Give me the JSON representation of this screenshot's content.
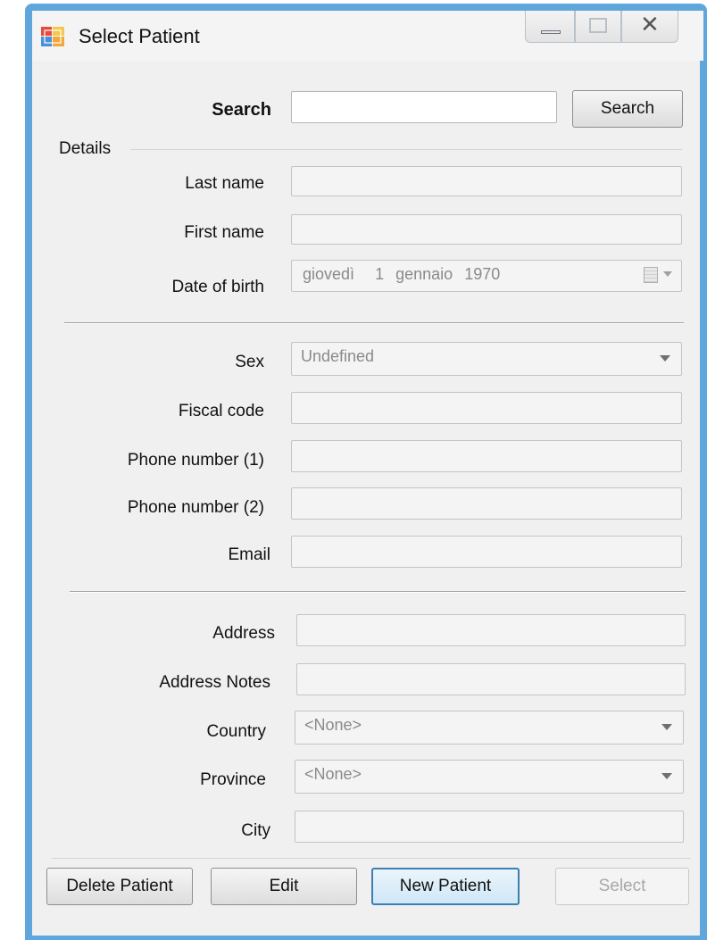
{
  "window": {
    "title": "Select Patient"
  },
  "search": {
    "label": "Search",
    "value": "",
    "button_label": "Search"
  },
  "details": {
    "group_label": "Details",
    "last_name": {
      "label": "Last name",
      "value": ""
    },
    "first_name": {
      "label": "First name",
      "value": ""
    },
    "date_of_birth": {
      "label": "Date of birth",
      "weekday": "giovedì",
      "day": "1",
      "month": "gennaio",
      "year": "1970"
    },
    "sex": {
      "label": "Sex",
      "value": "Undefined"
    },
    "fiscal_code": {
      "label": "Fiscal code",
      "value": ""
    },
    "phone1": {
      "label": "Phone number (1)",
      "value": ""
    },
    "phone2": {
      "label": "Phone number (2)",
      "value": ""
    },
    "email": {
      "label": "Email",
      "value": ""
    },
    "address": {
      "label": "Address",
      "value": ""
    },
    "address_notes": {
      "label": "Address Notes",
      "value": ""
    },
    "country": {
      "label": "Country",
      "value": "<None>"
    },
    "province": {
      "label": "Province",
      "value": "<None>"
    },
    "city": {
      "label": "City",
      "value": ""
    }
  },
  "actions": {
    "delete_label": "Delete Patient",
    "edit_label": "Edit",
    "new_label": "New Patient",
    "select_label": "Select"
  },
  "colors": {
    "window_frame": "#5fa6dd",
    "client_bg": "#f0f0f0",
    "default_button_border": "#3c7fb1"
  },
  "icons": {
    "app": "app-window-icon",
    "minimize": "minimize-icon",
    "maximize": "maximize-icon",
    "close": "close-icon",
    "calendar": "calendar-icon",
    "dropdown": "chevron-down-icon"
  }
}
